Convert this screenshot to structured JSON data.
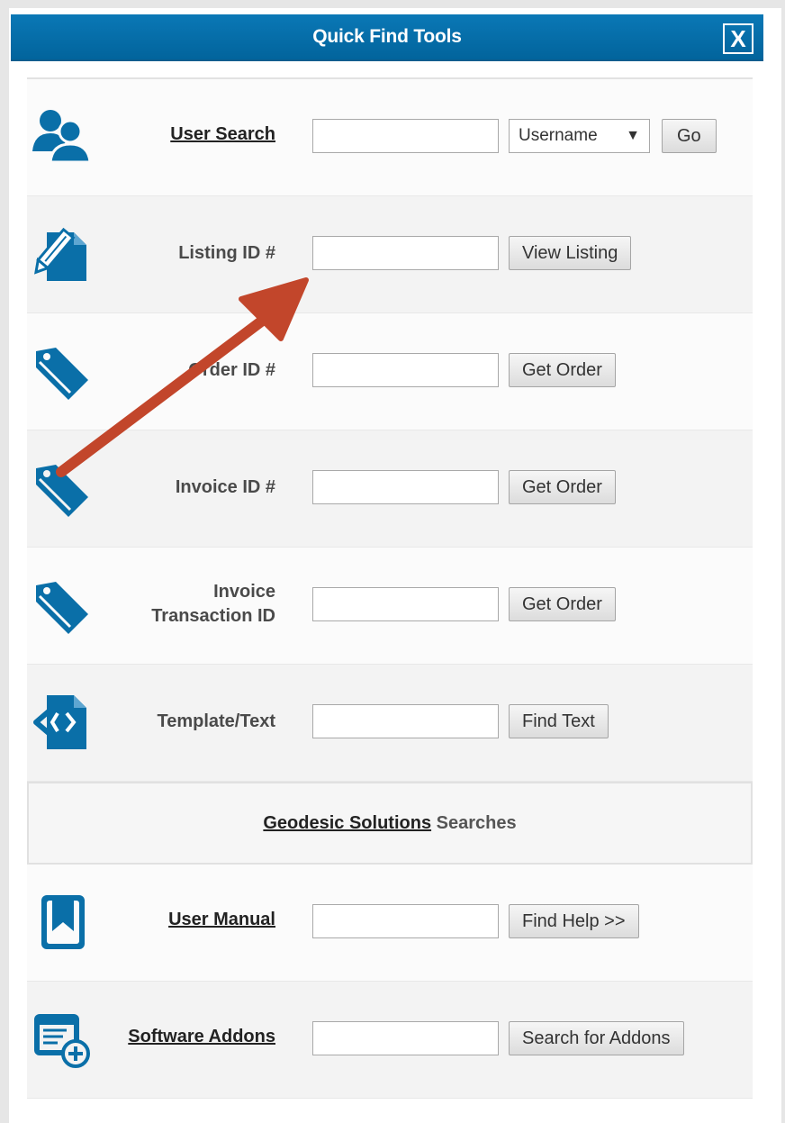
{
  "dialog": {
    "title": "Quick Find Tools",
    "close_label": "X"
  },
  "rows": [
    {
      "label": "User Search",
      "select_value": "Username",
      "select_caret": "▼",
      "button": "Go"
    },
    {
      "label": "Listing ID #",
      "button": "View Listing"
    },
    {
      "label": "Order ID #",
      "button": "Get Order"
    },
    {
      "label": "Invoice ID #",
      "button": "Get Order"
    },
    {
      "label_line1": "Invoice",
      "label_line2": "Transaction ID",
      "button": "Get Order"
    },
    {
      "label": "Template/Text",
      "button": "Find Text"
    }
  ],
  "section": {
    "link": "Geodesic Solutions",
    "suffix": "Searches"
  },
  "rows2": [
    {
      "label": "User Manual",
      "button": "Find Help >>"
    },
    {
      "label": "Software Addons",
      "button": "Search for Addons"
    }
  ],
  "colors": {
    "brand": "#02649c",
    "icon": "#0a6fa8",
    "annotation_arrow": "#c2462b"
  }
}
